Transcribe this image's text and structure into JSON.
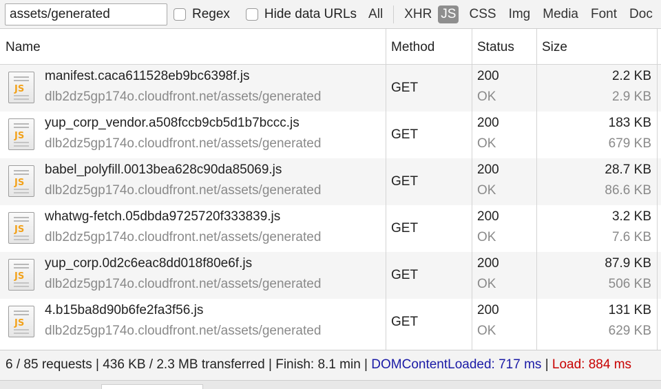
{
  "filter": {
    "value": "assets/generated",
    "regex_label": "Regex",
    "hide_data_urls_label": "Hide data URLs",
    "types": [
      "All",
      "XHR",
      "JS",
      "CSS",
      "Img",
      "Media",
      "Font",
      "Doc"
    ],
    "active_type": "JS"
  },
  "columns": {
    "name": "Name",
    "method": "Method",
    "status": "Status",
    "size": "Size"
  },
  "rows": [
    {
      "name": "manifest.caca611528eb9bc6398f.js",
      "domain": "dlb2dz5gp174o.cloudfront.net/assets/generated",
      "method": "GET",
      "status": "200",
      "status_text": "OK",
      "size": "2.2 KB",
      "content": "2.9 KB"
    },
    {
      "name": "yup_corp_vendor.a508fccb9cb5d1b7bccc.js",
      "domain": "dlb2dz5gp174o.cloudfront.net/assets/generated",
      "method": "GET",
      "status": "200",
      "status_text": "OK",
      "size": "183 KB",
      "content": "679 KB"
    },
    {
      "name": "babel_polyfill.0013bea628c90da85069.js",
      "domain": "dlb2dz5gp174o.cloudfront.net/assets/generated",
      "method": "GET",
      "status": "200",
      "status_text": "OK",
      "size": "28.7 KB",
      "content": "86.6 KB"
    },
    {
      "name": "whatwg-fetch.05dbda9725720f333839.js",
      "domain": "dlb2dz5gp174o.cloudfront.net/assets/generated",
      "method": "GET",
      "status": "200",
      "status_text": "OK",
      "size": "3.2 KB",
      "content": "7.6 KB"
    },
    {
      "name": "yup_corp.0d2c6eac8dd018f80e6f.js",
      "domain": "dlb2dz5gp174o.cloudfront.net/assets/generated",
      "method": "GET",
      "status": "200",
      "status_text": "OK",
      "size": "87.9 KB",
      "content": "506 KB"
    },
    {
      "name": "4.b15ba8d90b6fe2fa3f56.js",
      "domain": "dlb2dz5gp174o.cloudfront.net/assets/generated",
      "method": "GET",
      "status": "200",
      "status_text": "OK",
      "size": "131 KB",
      "content": "629 KB"
    }
  ],
  "summary": {
    "requests": "6 / 85 requests",
    "transferred": "436 KB / 2.3 MB transferred",
    "finish": "Finish: 8.1 min",
    "dom_content_loaded": "DOMContentLoaded: 717 ms",
    "load": "Load: 884 ms",
    "separator": "|"
  },
  "colors": {
    "dom_content_loaded": "#1a1aa6",
    "load": "#c80000",
    "js_icon": "#f2a21b",
    "active_filter": "#8e8e8e"
  },
  "icons": {
    "file_type": "js-file-icon"
  }
}
